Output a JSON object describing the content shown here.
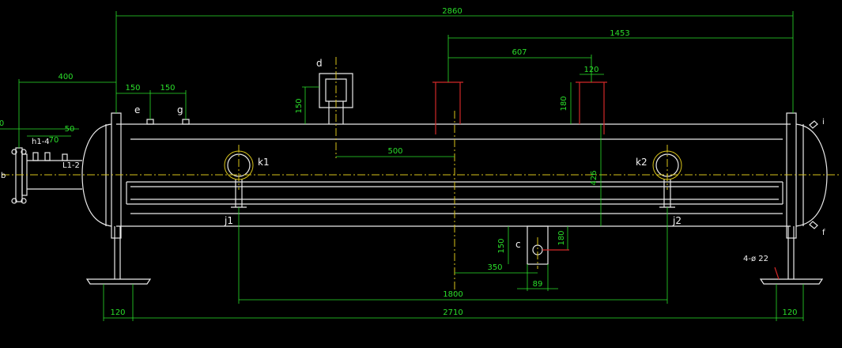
{
  "dimensions": {
    "overall_length": "2860",
    "right_nozzle_span": "1453",
    "nozzle_spacing_607": "607",
    "nozzle_width_120": "120",
    "nozzle_height_180": "180",
    "left_flange_400": "400",
    "nozzle_e_150": "150",
    "nozzle_g_150": "150",
    "nozzle_d_height": "150",
    "nozzle_d_offset": "500",
    "vessel_diameter": "426",
    "left_small_50": "50",
    "left_small_70": "70",
    "left_edge_0": "0",
    "nozzle_c_150": "150",
    "nozzle_c_180": "180",
    "nozzle_c_350": "350",
    "nozzle_c_89": "89",
    "support_span_1800": "1800",
    "bottom_2710": "2710",
    "support_120_left": "120",
    "support_120_right": "120",
    "bolt_holes": "4-ø 22"
  },
  "labels": {
    "d": "d",
    "e": "e",
    "g": "g",
    "k1": "k1",
    "k2": "k2",
    "j1": "j1",
    "j2": "j2",
    "c": "c",
    "b": "b",
    "h": "h1-4",
    "l": "L1-2",
    "i": "i",
    "f": "f"
  },
  "colors": {
    "background": "#000000",
    "outline": "#eaeaea",
    "dimension": "#2adf2a",
    "centerline": "#d7c21a",
    "nozzle_red": "#d12828"
  }
}
